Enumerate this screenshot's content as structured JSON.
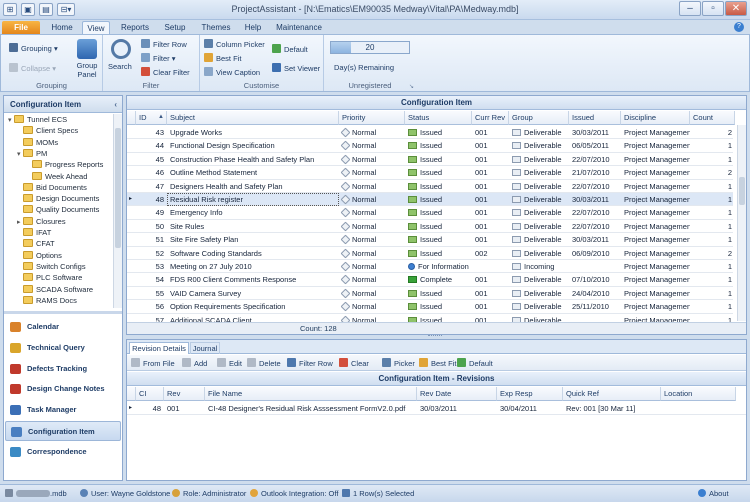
{
  "window": {
    "title": "ProjectAssistant - [N:\\Ematics\\EM90035 Medway\\Vital\\PA\\Medway.mdb]"
  },
  "ribbon_tabs": [
    "File",
    "Home",
    "View",
    "Reports",
    "Setup",
    "Themes",
    "Help",
    "Maintenance"
  ],
  "ribbon": {
    "grouping": {
      "label": "Grouping",
      "group_btn": "Grouping",
      "collapse_btn": "Collapse",
      "group_panel_btn": "Group Panel"
    },
    "filter": {
      "label": "Filter",
      "search_btn": "Search",
      "filter_row_btn": "Filter Row",
      "filter_btn": "Filter",
      "clear_filter_btn": "Clear Filter"
    },
    "customise": {
      "label": "Customise",
      "column_picker_btn": "Column Picker",
      "best_fit_btn": "Best Fit",
      "view_caption_btn": "View Caption",
      "default_btn": "Default",
      "set_viewer_btn": "Set Viewer"
    },
    "unregistered": {
      "label": "Unregistered",
      "days_value": "20",
      "days_label": "Day(s) Remaining",
      "days_fraction": 0.25
    }
  },
  "left_panel": {
    "title": "Configuration Item",
    "tree": [
      {
        "label": "Tunnel ECS",
        "level": 0,
        "expander": "▾"
      },
      {
        "label": "Client Specs",
        "level": 1,
        "expander": ""
      },
      {
        "label": "MOMs",
        "level": 1,
        "expander": ""
      },
      {
        "label": "PM",
        "level": 1,
        "expander": "▾"
      },
      {
        "label": "Progress Reports",
        "level": 2,
        "expander": ""
      },
      {
        "label": "Week Ahead",
        "level": 2,
        "expander": ""
      },
      {
        "label": "Bid Documents",
        "level": 1,
        "expander": ""
      },
      {
        "label": "Design Documents",
        "level": 1,
        "expander": ""
      },
      {
        "label": "Quality Documents",
        "level": 1,
        "expander": ""
      },
      {
        "label": "Closures",
        "level": 1,
        "expander": "▸"
      },
      {
        "label": "IFAT",
        "level": 1,
        "expander": ""
      },
      {
        "label": "CFAT",
        "level": 1,
        "expander": ""
      },
      {
        "label": "Options",
        "level": 1,
        "expander": ""
      },
      {
        "label": "Switch Configs",
        "level": 1,
        "expander": ""
      },
      {
        "label": "PLC Software",
        "level": 1,
        "expander": ""
      },
      {
        "label": "SCADA Software",
        "level": 1,
        "expander": ""
      },
      {
        "label": "RAMS Docs",
        "level": 1,
        "expander": ""
      }
    ],
    "nav": [
      {
        "label": "Calendar",
        "color": "#d9822b"
      },
      {
        "label": "Technical Query",
        "color": "#d9a52b"
      },
      {
        "label": "Defects Tracking",
        "color": "#c0392b"
      },
      {
        "label": "Design Change Notes",
        "color": "#c0392b"
      },
      {
        "label": "Task Manager",
        "color": "#3b6fb6"
      },
      {
        "label": "Configuration Item",
        "color": "#4a7fc1"
      },
      {
        "label": "Correspondence",
        "color": "#3b8ac4"
      }
    ]
  },
  "main": {
    "title": "Configuration Item",
    "columns": [
      "ID",
      "Subject",
      "Priority",
      "Status",
      "Curr Rev",
      "Group",
      "Issued",
      "Discipline",
      "Count"
    ],
    "rows": [
      [
        "43",
        "Upgrade Works",
        "Normal",
        "Issued",
        "001",
        "Deliverable",
        "30/03/2011",
        "Project Management",
        "2"
      ],
      [
        "44",
        "Functional Design Specification",
        "Normal",
        "Issued",
        "001",
        "Deliverable",
        "06/05/2011",
        "Project Management",
        "1"
      ],
      [
        "45",
        "Construction Phase Health and Safety Plan",
        "Normal",
        "Issued",
        "001",
        "Deliverable",
        "22/07/2010",
        "Project Management",
        "1"
      ],
      [
        "46",
        "Outline Method Statement",
        "Normal",
        "Issued",
        "001",
        "Deliverable",
        "21/07/2010",
        "Project Management",
        "2"
      ],
      [
        "47",
        "Designers Health and Safety Plan",
        "Normal",
        "Issued",
        "001",
        "Deliverable",
        "22/07/2010",
        "Project Management",
        "1"
      ],
      [
        "48",
        "Residual Risk register",
        "Normal",
        "Issued",
        "001",
        "Deliverable",
        "30/03/2011",
        "Project Management",
        "1"
      ],
      [
        "49",
        "Emergency Info",
        "Normal",
        "Issued",
        "001",
        "Deliverable",
        "22/07/2010",
        "Project Management",
        "1"
      ],
      [
        "50",
        "Site Rules",
        "Normal",
        "Issued",
        "001",
        "Deliverable",
        "22/07/2010",
        "Project Management",
        "1"
      ],
      [
        "51",
        "Site Fire Safety Plan",
        "Normal",
        "Issued",
        "001",
        "Deliverable",
        "30/03/2011",
        "Project Management",
        "1"
      ],
      [
        "52",
        "Software Coding Standards",
        "Normal",
        "Issued",
        "002",
        "Deliverable",
        "06/09/2010",
        "Project Management",
        "2"
      ],
      [
        "53",
        "Meeting on 27 July 2010",
        "Normal",
        "For Information",
        "",
        "Incoming",
        "",
        "Project Management",
        "1"
      ],
      [
        "54",
        "FDS R00 Client Comments Response",
        "Normal",
        "Complete",
        "001",
        "Deliverable",
        "07/10/2010",
        "Project Management",
        "1"
      ],
      [
        "55",
        "VAID Camera Survey",
        "Normal",
        "Issued",
        "001",
        "Deliverable",
        "24/04/2010",
        "Project Management",
        "1"
      ],
      [
        "56",
        "Option Requirements Specification",
        "Normal",
        "Issued",
        "001",
        "Deliverable",
        "25/11/2010",
        "Project Management",
        "1"
      ],
      [
        "57",
        "Additional SCADA Client",
        "Normal",
        "Issued",
        "001",
        "Deliverable",
        "",
        "Project Management",
        "1"
      ]
    ],
    "selected_index": 5,
    "count_label": "Count: 128"
  },
  "detail": {
    "tabs": [
      "Revision Details",
      "Journal"
    ],
    "toolbar": [
      "From File",
      "Add",
      "Edit",
      "Delete",
      "Filter Row",
      "Clear",
      "Picker",
      "Best Fit",
      "Default"
    ],
    "title": "Configuration Item - Revisions",
    "columns": [
      "CI",
      "Rev",
      "File Name",
      "Rev Date",
      "Exp Resp",
      "Quick Ref",
      "Location"
    ],
    "rows": [
      [
        "48",
        "001",
        "CI-48 Designer's Residual Risk Asssessment FormV2.0.pdf",
        "30/03/2011",
        "30/04/2011",
        "Rev: 001 [30 Mar 11]",
        ""
      ]
    ]
  },
  "status": {
    "db": ".mdb",
    "user": "User: Wayne Goldstone",
    "role": "Role: Administrator",
    "outlook": "Outlook Integration: Off",
    "selection": "1 Row(s) Selected",
    "about": "About"
  }
}
